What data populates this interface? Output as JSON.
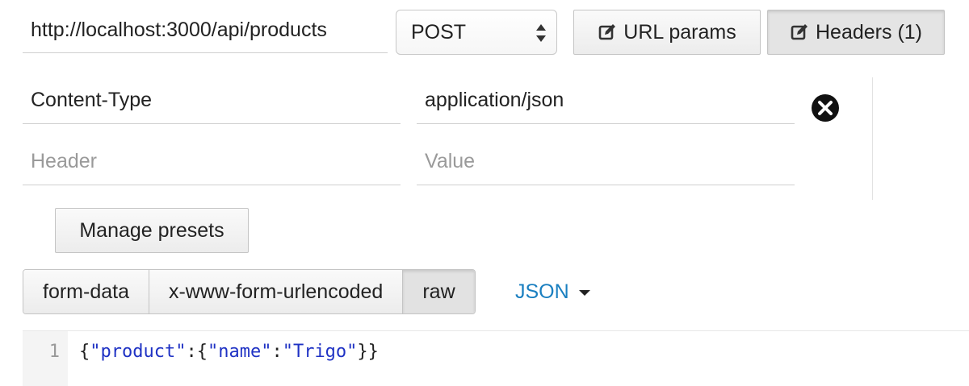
{
  "request": {
    "url": "http://localhost:3000/api/products",
    "method": "POST"
  },
  "toggles": {
    "url_params_label": "URL params",
    "headers_label": "Headers (1)"
  },
  "headers": {
    "rows": [
      {
        "key": "Content-Type",
        "value": "application/json"
      }
    ],
    "new_row": {
      "key_placeholder": "Header",
      "value_placeholder": "Value"
    }
  },
  "presets": {
    "label": "Manage presets"
  },
  "body_type": {
    "options": [
      "form-data",
      "x-www-form-urlencoded",
      "raw"
    ],
    "selected": "raw",
    "format": "JSON"
  },
  "editor": {
    "line_number": "1",
    "tokens": [
      "{",
      "\"product\"",
      ":",
      "{",
      "\"name\"",
      ":",
      "\"Trigo\"",
      "}}"
    ]
  },
  "icons": {
    "method_arrows": "up-down-arrows-icon",
    "edit": "edit-icon",
    "remove": "close-circle-icon",
    "dropdown": "caret-down-icon"
  },
  "colors": {
    "link": "#1a7fc0",
    "string_token": "#1f32c4"
  }
}
